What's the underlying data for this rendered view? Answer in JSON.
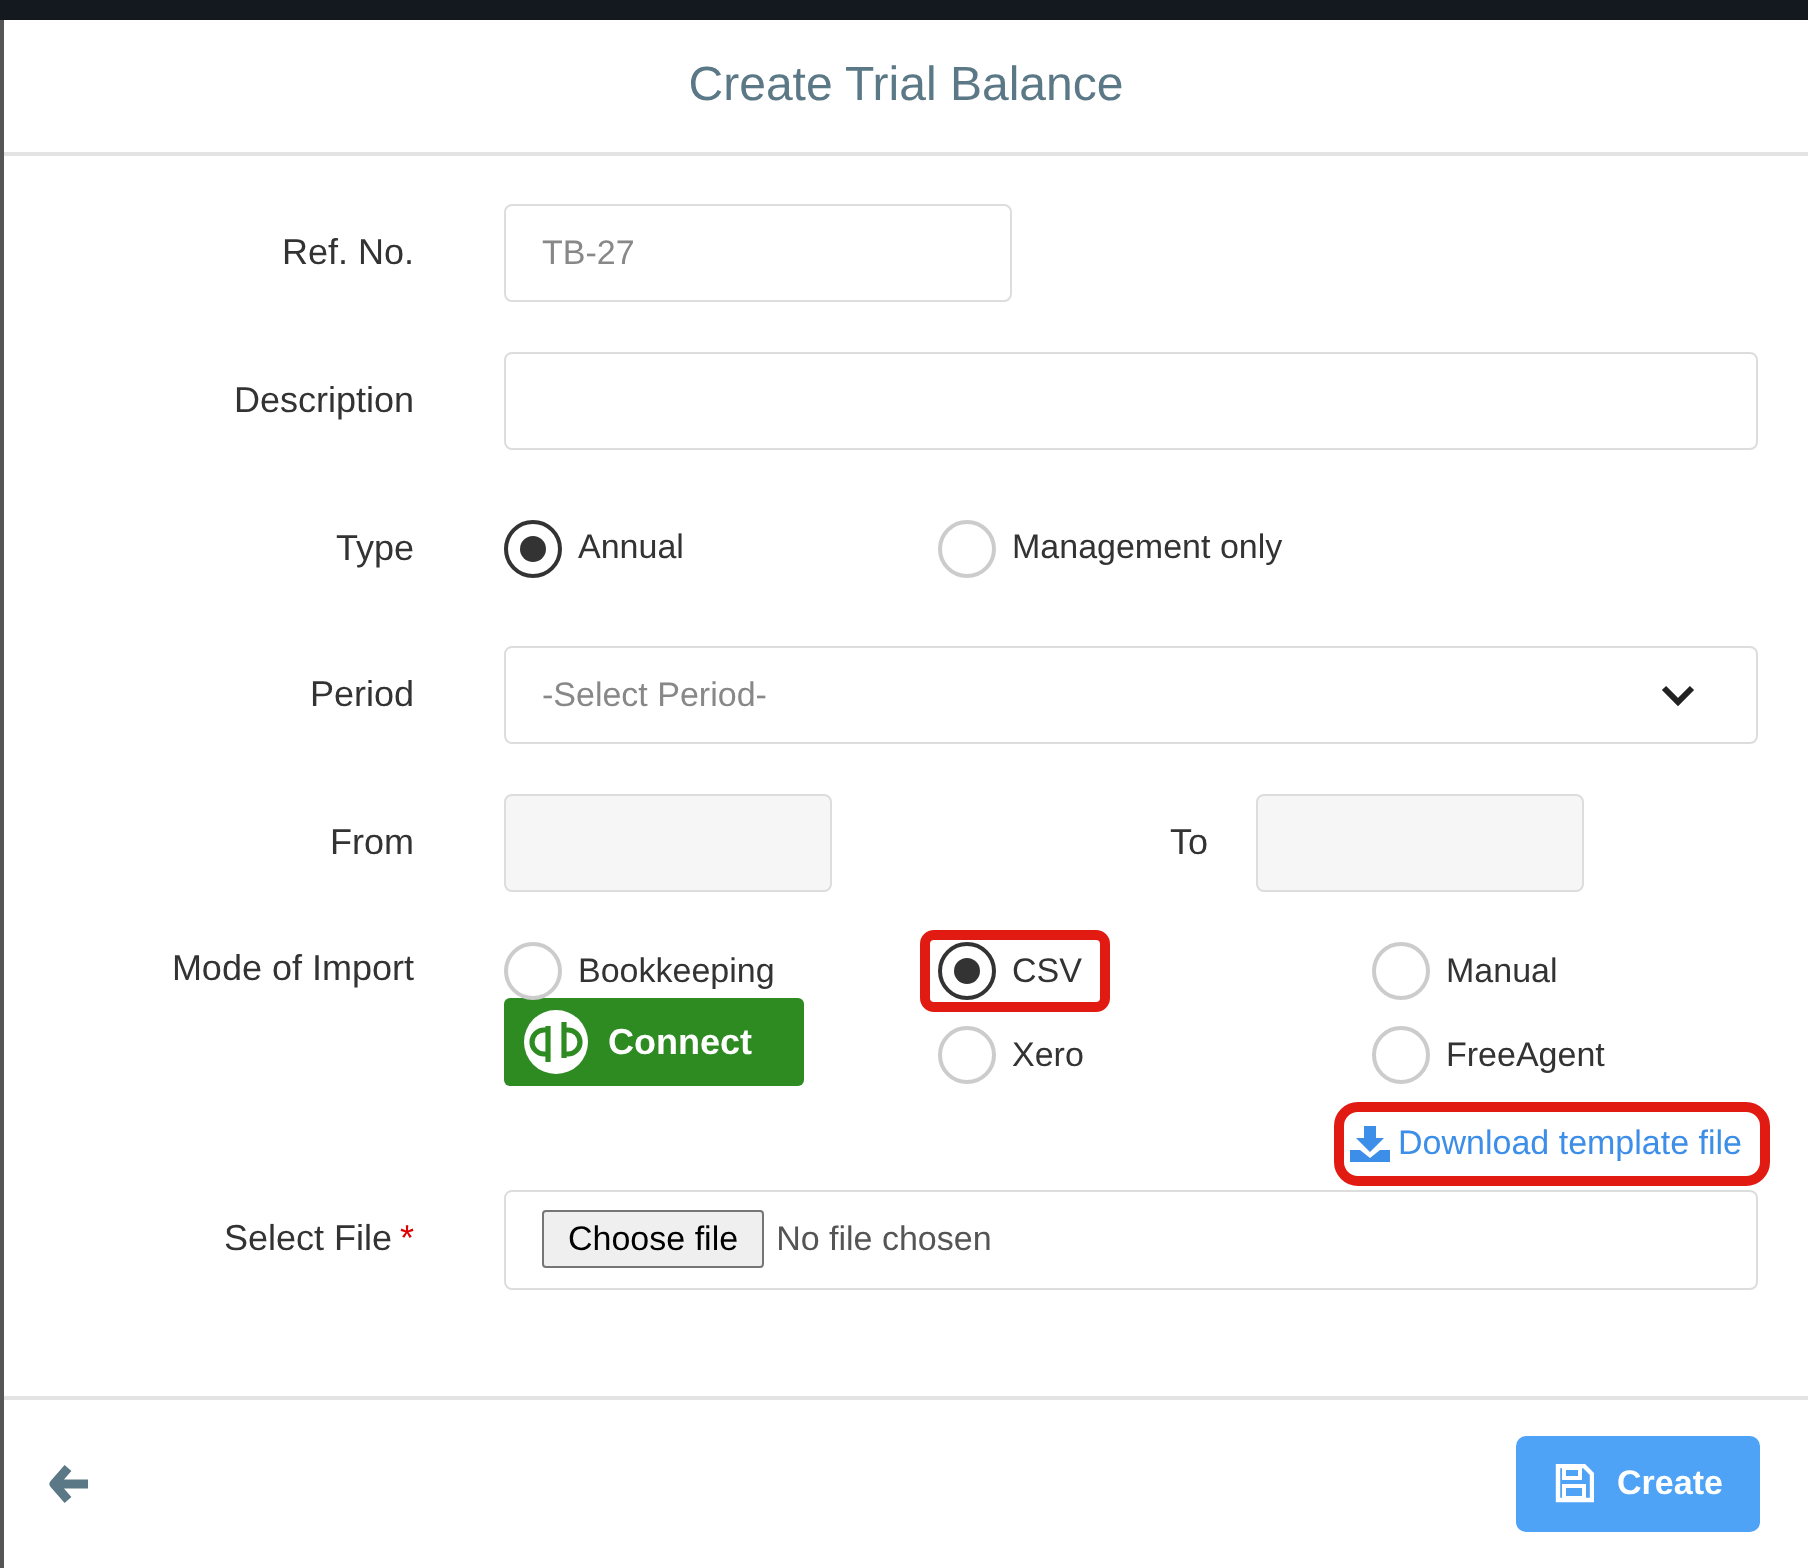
{
  "dialog": {
    "title": "Create Trial Balance"
  },
  "ref_no": {
    "label": "Ref. No.",
    "placeholder": "TB-27"
  },
  "description": {
    "label": "Description"
  },
  "type": {
    "label": "Type",
    "options": [
      {
        "label": "Annual",
        "selected": true
      },
      {
        "label": "Management only",
        "selected": false
      }
    ]
  },
  "period": {
    "label": "Period",
    "placeholder": "-Select Period-"
  },
  "date_range": {
    "from_label": "From",
    "to_label": "To"
  },
  "mode_of_import": {
    "label": "Mode of Import",
    "connect_button": "Connect",
    "options": [
      {
        "label": "Bookkeeping",
        "selected": false,
        "highlighted": false
      },
      {
        "label": "CSV",
        "selected": true,
        "highlighted": true
      },
      {
        "label": "Manual",
        "selected": false,
        "highlighted": false
      },
      {
        "label": "Xero",
        "selected": false,
        "highlighted": false
      },
      {
        "label": "FreeAgent",
        "selected": false,
        "highlighted": false
      }
    ]
  },
  "download_link": {
    "text": "Download template file",
    "highlighted": true
  },
  "select_file": {
    "label": "Select File",
    "required_mark": "*",
    "button": "Choose file",
    "status": "No file chosen"
  },
  "footer": {
    "create_button": "Create"
  }
}
